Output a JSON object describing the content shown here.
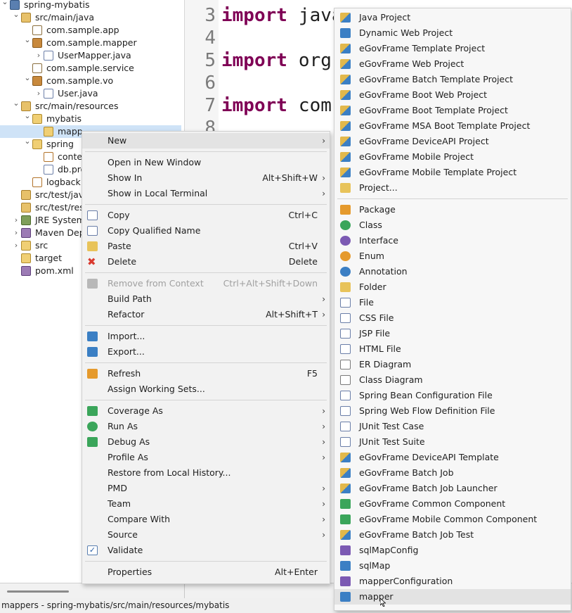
{
  "tree": {
    "items": [
      {
        "label": "spring-mybatis",
        "icon": "project-icon",
        "twisty": "expanded"
      },
      {
        "label": "src/main/java",
        "icon": "source-folder-icon",
        "twisty": "expanded"
      },
      {
        "label": "com.sample.app",
        "icon": "package-empty-icon",
        "twisty": ""
      },
      {
        "label": "com.sample.mapper",
        "icon": "package-icon",
        "twisty": "expanded"
      },
      {
        "label": "UserMapper.java",
        "icon": "java-interface-icon",
        "twisty": "collapsed"
      },
      {
        "label": "com.sample.service",
        "icon": "package-empty-icon",
        "twisty": ""
      },
      {
        "label": "com.sample.vo",
        "icon": "package-icon",
        "twisty": "expanded"
      },
      {
        "label": "User.java",
        "icon": "java-file-icon",
        "twisty": "collapsed"
      },
      {
        "label": "src/main/resources",
        "icon": "source-folder-icon",
        "twisty": "expanded"
      },
      {
        "label": "mybatis",
        "icon": "folder-icon",
        "twisty": "expanded"
      },
      {
        "label": "mapp",
        "icon": "folder-icon",
        "twisty": ""
      },
      {
        "label": "spring",
        "icon": "folder-icon",
        "twisty": "expanded"
      },
      {
        "label": "contex",
        "icon": "xml-file-icon",
        "twisty": ""
      },
      {
        "label": "db.pro",
        "icon": "properties-file-icon",
        "twisty": ""
      },
      {
        "label": "logback.x",
        "icon": "xml-file-icon",
        "twisty": ""
      },
      {
        "label": "src/test/java",
        "icon": "source-folder-icon",
        "twisty": ""
      },
      {
        "label": "src/test/reso",
        "icon": "source-folder-icon",
        "twisty": ""
      },
      {
        "label": "JRE System",
        "icon": "library-icon",
        "twisty": "collapsed"
      },
      {
        "label": "Maven Depe",
        "icon": "maven-library-icon",
        "twisty": "collapsed"
      },
      {
        "label": "src",
        "icon": "folder-icon",
        "twisty": "collapsed"
      },
      {
        "label": "target",
        "icon": "folder-icon",
        "twisty": ""
      },
      {
        "label": "pom.xml",
        "icon": "maven-pom-icon",
        "twisty": ""
      }
    ]
  },
  "editor": {
    "lines": [
      {
        "num": "3",
        "keyword": "import",
        "text": "java"
      },
      {
        "num": "4",
        "keyword": "",
        "text": ""
      },
      {
        "num": "5",
        "keyword": "import",
        "text": "org."
      },
      {
        "num": "6",
        "keyword": "",
        "text": ""
      },
      {
        "num": "7",
        "keyword": "import",
        "text": "com."
      },
      {
        "num": "8",
        "keyword": "",
        "text": ""
      }
    ]
  },
  "context_menu": {
    "items": [
      {
        "label": "New",
        "shortcut": "",
        "submenu": true,
        "icon": "",
        "disabled": false,
        "highlighted": true
      },
      {
        "separator": true
      },
      {
        "label": "Open in New Window",
        "shortcut": "",
        "submenu": false,
        "icon": ""
      },
      {
        "label": "Show In",
        "shortcut": "Alt+Shift+W",
        "submenu": true,
        "icon": ""
      },
      {
        "label": "Show in Local Terminal",
        "shortcut": "",
        "submenu": true,
        "icon": ""
      },
      {
        "separator": true
      },
      {
        "label": "Copy",
        "shortcut": "Ctrl+C",
        "submenu": false,
        "icon": "copy-icon"
      },
      {
        "label": "Copy Qualified Name",
        "shortcut": "",
        "submenu": false,
        "icon": "copy-qualified-name-icon"
      },
      {
        "label": "Paste",
        "shortcut": "Ctrl+V",
        "submenu": false,
        "icon": "paste-icon"
      },
      {
        "label": "Delete",
        "shortcut": "Delete",
        "submenu": false,
        "icon": "delete-icon"
      },
      {
        "separator": true
      },
      {
        "label": "Remove from Context",
        "shortcut": "Ctrl+Alt+Shift+Down",
        "submenu": false,
        "icon": "remove-context-icon",
        "disabled": true
      },
      {
        "label": "Build Path",
        "shortcut": "",
        "submenu": true,
        "icon": ""
      },
      {
        "label": "Refactor",
        "shortcut": "Alt+Shift+T",
        "submenu": true,
        "icon": ""
      },
      {
        "separator": true
      },
      {
        "label": "Import...",
        "shortcut": "",
        "submenu": false,
        "icon": "import-icon"
      },
      {
        "label": "Export...",
        "shortcut": "",
        "submenu": false,
        "icon": "export-icon"
      },
      {
        "separator": true
      },
      {
        "label": "Refresh",
        "shortcut": "F5",
        "submenu": false,
        "icon": "refresh-icon"
      },
      {
        "label": "Assign Working Sets...",
        "shortcut": "",
        "submenu": false,
        "icon": ""
      },
      {
        "separator": true
      },
      {
        "label": "Coverage As",
        "shortcut": "",
        "submenu": true,
        "icon": "coverage-icon"
      },
      {
        "label": "Run As",
        "shortcut": "",
        "submenu": true,
        "icon": "run-icon"
      },
      {
        "label": "Debug As",
        "shortcut": "",
        "submenu": true,
        "icon": "debug-icon"
      },
      {
        "label": "Profile As",
        "shortcut": "",
        "submenu": true,
        "icon": ""
      },
      {
        "label": "Restore from Local History...",
        "shortcut": "",
        "submenu": false,
        "icon": ""
      },
      {
        "label": "PMD",
        "shortcut": "",
        "submenu": true,
        "icon": ""
      },
      {
        "label": "Team",
        "shortcut": "",
        "submenu": true,
        "icon": ""
      },
      {
        "label": "Compare With",
        "shortcut": "",
        "submenu": true,
        "icon": ""
      },
      {
        "label": "Source",
        "shortcut": "",
        "submenu": true,
        "icon": ""
      },
      {
        "label": "Validate",
        "shortcut": "",
        "submenu": false,
        "icon": "validate-check-icon"
      },
      {
        "separator": true
      },
      {
        "label": "Properties",
        "shortcut": "Alt+Enter",
        "submenu": false,
        "icon": ""
      }
    ]
  },
  "new_submenu": {
    "items": [
      {
        "label": "Java Project",
        "icon": "java-project-icon",
        "tone": "t-mix"
      },
      {
        "label": "Dynamic Web Project",
        "icon": "dynamic-web-project-icon",
        "tone": "t-blue"
      },
      {
        "label": "eGovFrame Template Project",
        "icon": "egovframe-template-project-icon",
        "tone": "t-mix"
      },
      {
        "label": "eGovFrame Web Project",
        "icon": "egovframe-web-project-icon",
        "tone": "t-mix"
      },
      {
        "label": "eGovFrame Batch Template Project",
        "icon": "egovframe-batch-template-icon",
        "tone": "t-mix"
      },
      {
        "label": "eGovFrame Boot Web Project",
        "icon": "egovframe-boot-web-icon",
        "tone": "t-mix"
      },
      {
        "label": "eGovFrame Boot Template Project",
        "icon": "egovframe-boot-template-icon",
        "tone": "t-mix"
      },
      {
        "label": "eGovFrame MSA Boot Template Project",
        "icon": "egovframe-msa-boot-icon",
        "tone": "t-mix"
      },
      {
        "label": "eGovFrame DeviceAPI Project",
        "icon": "egovframe-deviceapi-project-icon",
        "tone": "t-mix"
      },
      {
        "label": "eGovFrame Mobile Project",
        "icon": "egovframe-mobile-project-icon",
        "tone": "t-mix"
      },
      {
        "label": "eGovFrame Mobile Template Project",
        "icon": "egovframe-mobile-template-icon",
        "tone": "t-mix"
      },
      {
        "label": "Project...",
        "icon": "project-wizard-icon",
        "tone": "t-yellow"
      },
      {
        "separator": true
      },
      {
        "label": "Package",
        "icon": "package-icon",
        "tone": "t-orange"
      },
      {
        "label": "Class",
        "icon": "class-icon",
        "tone": "t-green",
        "round": true
      },
      {
        "label": "Interface",
        "icon": "interface-icon",
        "tone": "t-purple",
        "round": true
      },
      {
        "label": "Enum",
        "icon": "enum-icon",
        "tone": "t-orange",
        "round": true
      },
      {
        "label": "Annotation",
        "icon": "annotation-icon",
        "tone": "t-blue",
        "round": true
      },
      {
        "label": "Folder",
        "icon": "folder-icon",
        "tone": "t-yellow"
      },
      {
        "label": "File",
        "icon": "file-icon",
        "tone": "t-doc"
      },
      {
        "label": "CSS File",
        "icon": "css-file-icon",
        "tone": "t-doc"
      },
      {
        "label": "JSP File",
        "icon": "jsp-file-icon",
        "tone": "t-doc"
      },
      {
        "label": "HTML File",
        "icon": "html-file-icon",
        "tone": "t-doc"
      },
      {
        "label": "ER Diagram",
        "icon": "er-diagram-icon",
        "tone": "t-grid"
      },
      {
        "label": "Class Diagram",
        "icon": "class-diagram-icon",
        "tone": "t-grid"
      },
      {
        "label": "Spring Bean Configuration File",
        "icon": "spring-bean-config-icon",
        "tone": "t-doc"
      },
      {
        "label": "Spring Web Flow Definition File",
        "icon": "spring-web-flow-icon",
        "tone": "t-doc"
      },
      {
        "label": "JUnit Test Case",
        "icon": "junit-test-case-icon",
        "tone": "t-doc"
      },
      {
        "label": "JUnit Test Suite",
        "icon": "junit-test-suite-icon",
        "tone": "t-doc"
      },
      {
        "label": "eGovFrame DeviceAPI Template",
        "icon": "egovframe-deviceapi-template-icon",
        "tone": "t-mix"
      },
      {
        "label": "eGovFrame Batch Job",
        "icon": "egovframe-batch-job-icon",
        "tone": "t-mix"
      },
      {
        "label": "eGovFrame Batch Job Launcher",
        "icon": "egovframe-batch-job-launcher-icon",
        "tone": "t-mix"
      },
      {
        "label": "eGovFrame Common Component",
        "icon": "egovframe-common-component-icon",
        "tone": "t-green"
      },
      {
        "label": "eGovFrame Mobile Common Component",
        "icon": "egovframe-mobile-common-component-icon",
        "tone": "t-green"
      },
      {
        "label": "eGovFrame Batch Job Test",
        "icon": "egovframe-batch-job-test-icon",
        "tone": "t-mix"
      },
      {
        "label": "sqlMapConfig",
        "icon": "sqlmapconfig-icon",
        "tone": "t-purple"
      },
      {
        "label": "sqlMap",
        "icon": "sqlmap-icon",
        "tone": "t-blue"
      },
      {
        "label": "mapperConfiguration",
        "icon": "mapper-configuration-icon",
        "tone": "t-purple"
      },
      {
        "label": "mapper",
        "icon": "mapper-icon",
        "tone": "t-blue",
        "highlighted": true
      }
    ]
  },
  "status_bar": {
    "text": "mappers - spring-mybatis/src/main/resources/mybatis"
  }
}
